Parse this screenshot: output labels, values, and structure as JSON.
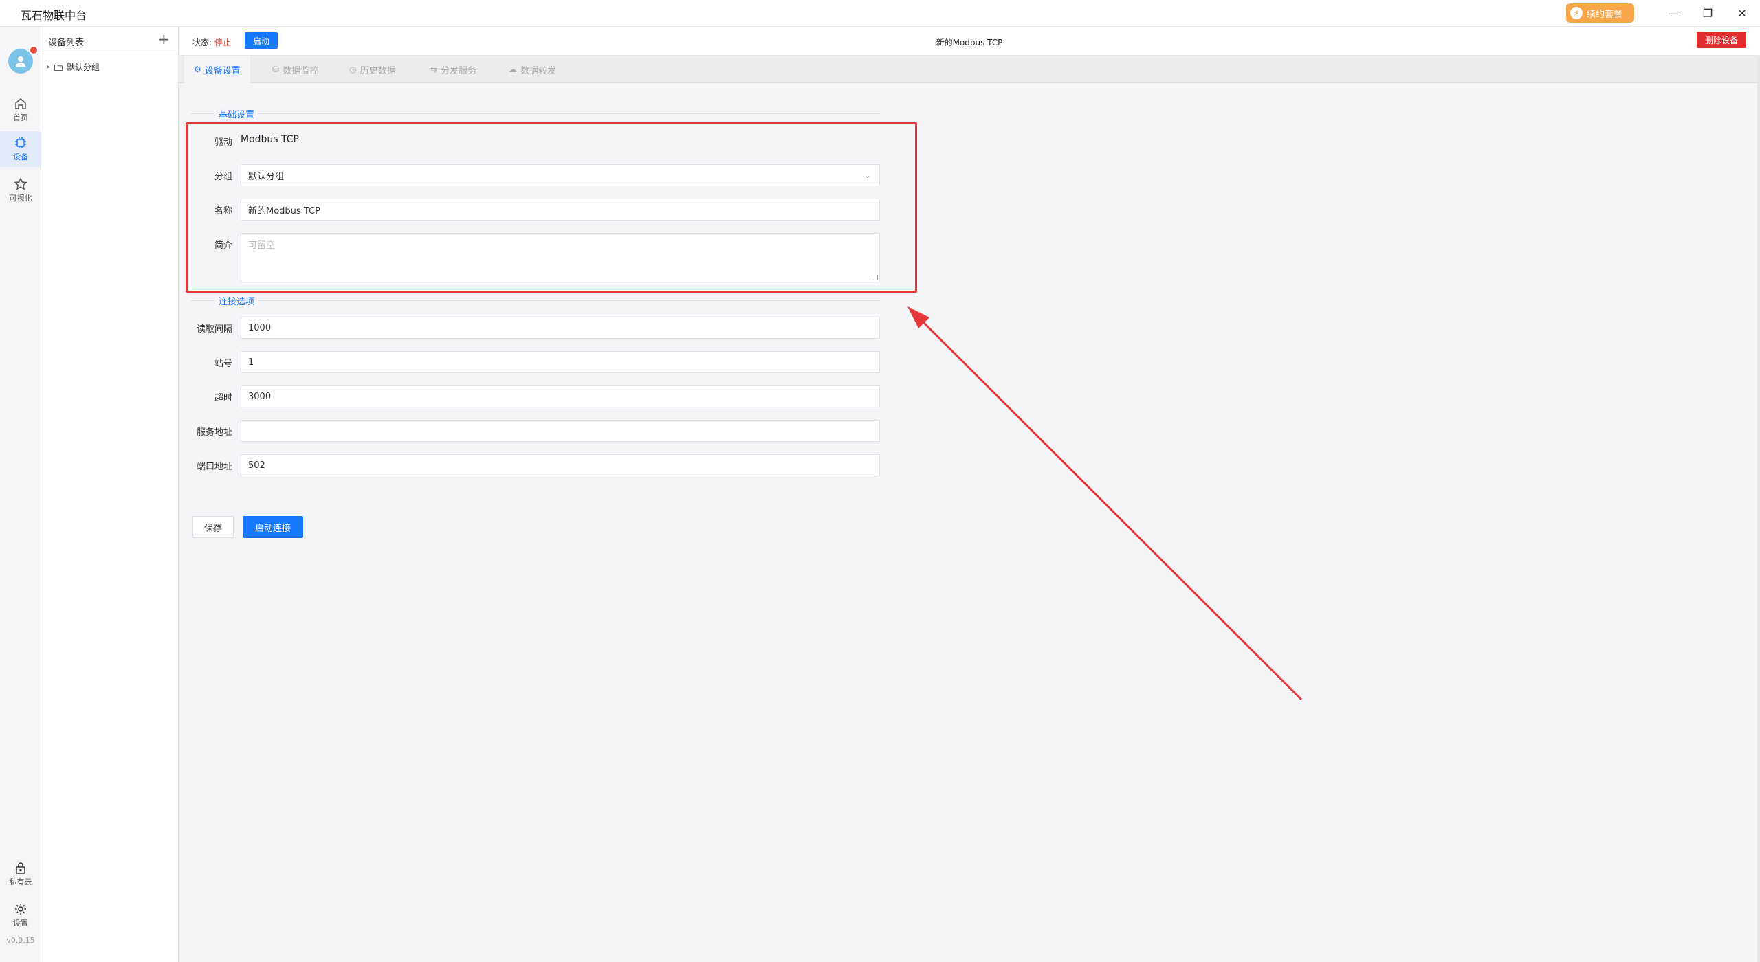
{
  "app": {
    "title": "瓦石物联中台",
    "renew_label": "续约套餐",
    "version": "v0.0.15"
  },
  "nav": {
    "home": "首页",
    "device": "设备",
    "visual": "可视化",
    "private_cloud": "私有云",
    "settings": "设置"
  },
  "device_list": {
    "title": "设备列表",
    "add": "+",
    "groups": [
      {
        "label": "默认分组"
      }
    ]
  },
  "header": {
    "status_label": "状态:",
    "status_value": "停止",
    "start_label": "启动",
    "device_name": "新的Modbus TCP",
    "delete_label": "删除设备"
  },
  "tabs": [
    {
      "label": "设备设置",
      "icon": "gear-icon"
    },
    {
      "label": "数据监控",
      "icon": "database-icon"
    },
    {
      "label": "历史数据",
      "icon": "clock-icon"
    },
    {
      "label": "分发服务",
      "icon": "share-icon"
    },
    {
      "label": "数据转发",
      "icon": "cloud-icon"
    }
  ],
  "form": {
    "basic_section": "基础设置",
    "driver_label": "驱动",
    "driver_value": "Modbus TCP",
    "group_label": "分组",
    "group_value": "默认分组",
    "name_label": "名称",
    "name_value": "新的Modbus TCP",
    "desc_label": "简介",
    "desc_placeholder": "可留空",
    "conn_section": "连接选项",
    "interval_label": "读取间隔",
    "interval_value": "1000",
    "station_label": "站号",
    "station_value": "1",
    "timeout_label": "超时",
    "timeout_value": "3000",
    "address_label": "服务地址",
    "address_value": "",
    "port_label": "端口地址",
    "port_value": "502",
    "save_label": "保存",
    "connect_label": "启动连接"
  },
  "colors": {
    "accent": "#1677ff",
    "danger": "#e02e2e",
    "annotation": "#e5383b",
    "renew": "#f7a64a"
  }
}
